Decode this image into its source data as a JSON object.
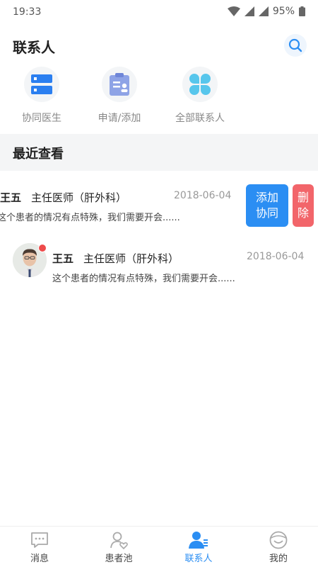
{
  "status_bar": {
    "time": "19:33",
    "battery": "95%"
  },
  "header": {
    "title": "联系人"
  },
  "shortcuts": [
    {
      "label": "协同医生",
      "icon": "server-icon"
    },
    {
      "label": "申请/添加",
      "icon": "clipboard-icon"
    },
    {
      "label": "全部联系人",
      "icon": "clover-icon"
    }
  ],
  "recent": {
    "title": "最近查看",
    "items": [
      {
        "name": "王五",
        "title": "主任医师（肝外科）",
        "date": "2018-06-04",
        "message": "这个患者的情况有点特殊，我们需要开会......",
        "actions": {
          "add": "添加\n协同",
          "add_line1": "添加",
          "add_line2": "协同",
          "delete_line1": "删",
          "delete_line2": "除"
        }
      },
      {
        "name": "王五",
        "title": "主任医师（肝外科）",
        "date": "2018-06-04",
        "message": "这个患者的情况有点特殊，我们需要开会......"
      }
    ]
  },
  "tabbar": [
    {
      "label": "消息",
      "icon": "message-icon"
    },
    {
      "label": "患者池",
      "icon": "patient-icon"
    },
    {
      "label": "联系人",
      "icon": "contacts-icon",
      "active": true
    },
    {
      "label": "我的",
      "icon": "profile-icon"
    }
  ],
  "colors": {
    "accent": "#2b8ef3",
    "danger": "#f2656a",
    "badge": "#ee4b4b"
  }
}
